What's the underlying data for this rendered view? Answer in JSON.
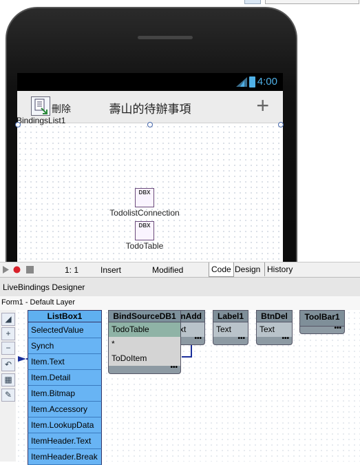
{
  "device": {
    "status_time": "4:00",
    "toolbar": {
      "delete_label": "刪除",
      "title": "壽山的待辦事項",
      "add_glyph": "+"
    },
    "bindings_caption": "BindingsList1",
    "components": [
      {
        "icon_text": "DBX",
        "caption": "TodolistConnection"
      },
      {
        "icon_text": "DBX",
        "caption": "TodoTable"
      }
    ]
  },
  "editor_status": {
    "position": "1:  1",
    "mode": "Insert",
    "state": "Modified",
    "tabs": [
      "Code",
      "Design",
      "History"
    ]
  },
  "livebindings": {
    "title": "LiveBindings Designer",
    "layer": "Form1  - Default Layer",
    "listbox": {
      "name": "ListBox1",
      "members": [
        "SelectedValue",
        "Synch",
        "Item.Text",
        "Item.Detail",
        "Item.Bitmap",
        "Item.Accessory",
        "Item.LookupData",
        "ItemHeader.Text",
        "ItemHeader.Break"
      ]
    },
    "bindsource": {
      "name": "BindSourceDB1",
      "members": [
        "TodoTable",
        "*",
        "ToDoItem"
      ]
    },
    "btnadd": {
      "name": "BtnAdd",
      "name_visible": "nAdd",
      "member_visible": "xt"
    },
    "label1": {
      "name": "Label1",
      "member": "Text"
    },
    "btndel": {
      "name": "BtnDel",
      "member": "Text"
    },
    "toolbar1": {
      "name": "ToolBar1"
    },
    "more_glyph": "•••"
  }
}
